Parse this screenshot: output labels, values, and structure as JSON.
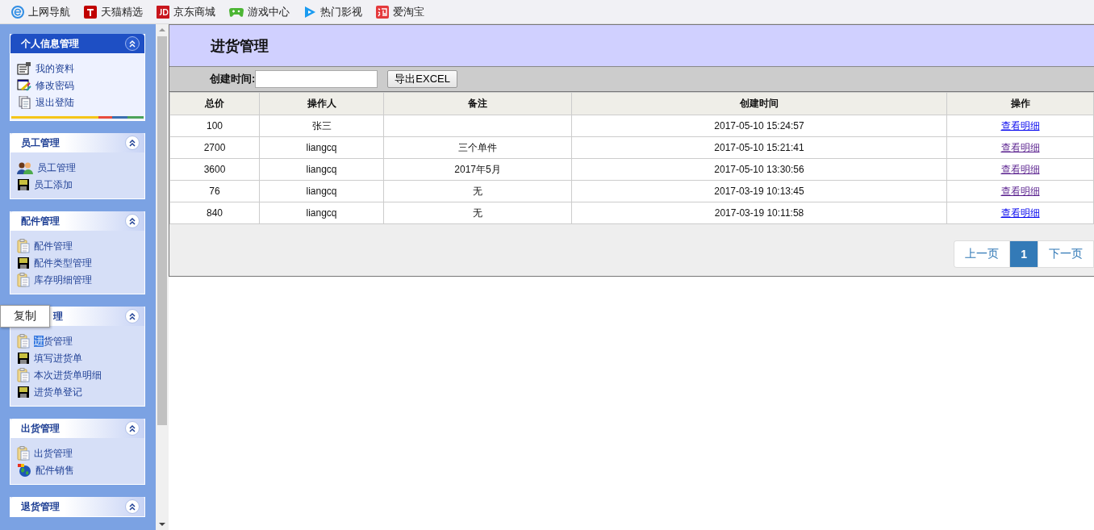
{
  "bookmarks": [
    {
      "label": "上网导航",
      "kind": "ie"
    },
    {
      "label": "天猫精选",
      "kind": "tmall"
    },
    {
      "label": "京东商城",
      "kind": "jd"
    },
    {
      "label": "游戏中心",
      "kind": "game"
    },
    {
      "label": "热门影视",
      "kind": "video"
    },
    {
      "label": "爱淘宝",
      "kind": "taobao"
    }
  ],
  "sidebar": [
    {
      "title": "个人信息管理",
      "kind": "primary",
      "items": [
        {
          "text": "我的资料",
          "kind": "profile"
        },
        {
          "text": "修改密码",
          "kind": "edit"
        },
        {
          "text": "退出登陆",
          "kind": "document"
        }
      ]
    },
    {
      "title": "员工管理",
      "kind": "normal",
      "items": [
        {
          "text": "员工管理",
          "kind": "people"
        },
        {
          "text": "员工添加",
          "kind": "floppy"
        }
      ]
    },
    {
      "title": "配件管理",
      "kind": "normal",
      "items": [
        {
          "text": "配件管理",
          "kind": "clipboard"
        },
        {
          "text": "配件类型管理",
          "kind": "floppy"
        },
        {
          "text": "库存明细管理",
          "kind": "clipboard"
        }
      ]
    },
    {
      "title": "理",
      "kind": "normal",
      "context_menu": "复制",
      "items": [
        {
          "parts": [
            {
              "text": "进",
              "highlighted": true
            },
            {
              "text": "货管理",
              "highlighted": false
            }
          ],
          "kind": "clipboard"
        },
        {
          "text": "填写进货单",
          "kind": "floppy"
        },
        {
          "text": "本次进货单明细",
          "kind": "clipboard"
        },
        {
          "text": "进货单登记",
          "kind": "floppy"
        }
      ]
    },
    {
      "title": "出货管理",
      "kind": "normal",
      "items": [
        {
          "text": "出货管理",
          "kind": "clipboard"
        },
        {
          "text": "配件销售",
          "kind": "globe"
        }
      ]
    },
    {
      "title": "退货管理",
      "kind": "normal"
    }
  ],
  "page": {
    "title": "进货管理",
    "filter_label": "创建时间:",
    "export_button": "导出EXCEL"
  },
  "table": {
    "columns": [
      "总价",
      "操作人",
      "备注",
      "创建时间",
      "操作"
    ],
    "rows": [
      {
        "cells": [
          "100",
          "张三",
          "",
          "2017-05-10 15:24:57"
        ],
        "link": "查看明细",
        "visited": false
      },
      {
        "cells": [
          "2700",
          "liangcq",
          "三个单件",
          "2017-05-10 15:21:41"
        ],
        "link": "查看明细",
        "visited": true
      },
      {
        "cells": [
          "3600",
          "liangcq",
          "2017年5月",
          "2017-05-10 13:30:56"
        ],
        "link": "查看明细",
        "visited": true
      },
      {
        "cells": [
          "76",
          "liangcq",
          "无",
          "2017-03-19 10:13:45"
        ],
        "link": "查看明细",
        "visited": true
      },
      {
        "cells": [
          "840",
          "liangcq",
          "无",
          "2017-03-19 10:11:58"
        ],
        "link": "查看明细",
        "visited": false
      }
    ]
  },
  "pagination": [
    {
      "label": "上一页",
      "selected": false
    },
    {
      "label": "1",
      "selected": true
    },
    {
      "label": "下一页",
      "selected": false
    }
  ]
}
